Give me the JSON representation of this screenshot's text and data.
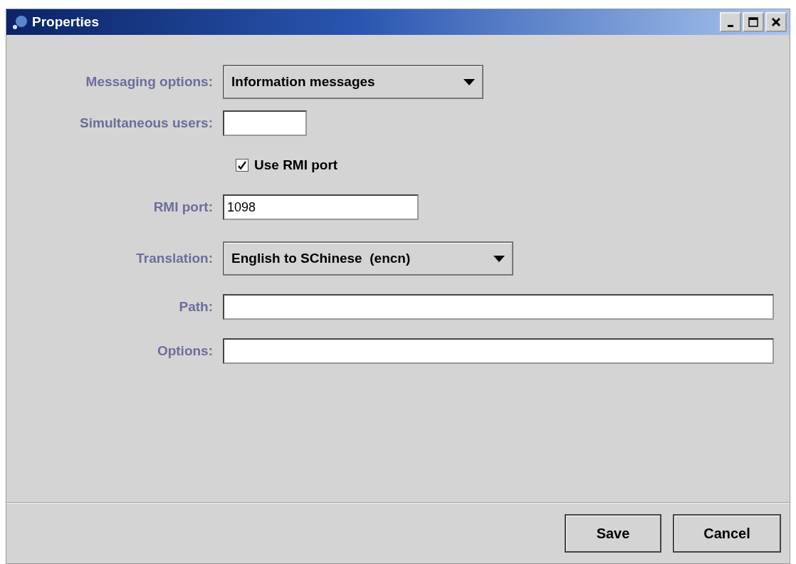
{
  "window": {
    "title": "Properties"
  },
  "fields": [
    {
      "kind": "dropdown",
      "label": "Messaging options:",
      "value": "Information messages"
    },
    {
      "kind": "text",
      "label": "Simultaneous users:"
    },
    {
      "kind": "checkbox",
      "label": "Use RMI port",
      "checked": true
    },
    {
      "kind": "text",
      "label": "RMI port:",
      "value": "1098"
    },
    {
      "kind": "dropdown",
      "label": "Translation:",
      "value": "English to SChinese  (encn)"
    },
    {
      "kind": "text",
      "label": "Path:"
    },
    {
      "kind": "text",
      "label": "Options:"
    }
  ],
  "buttons": [
    "Save",
    "Cancel"
  ]
}
